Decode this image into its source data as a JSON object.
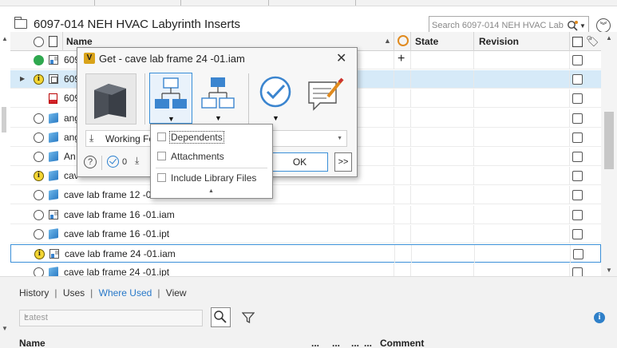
{
  "window": {
    "title": "6097-014 NEH HVAC Labyrinth Inserts",
    "search_placeholder": "Search 6097-014 NEH HVAC Labyrint"
  },
  "grid": {
    "columns": {
      "name": "Name",
      "state": "State",
      "revision": "Revision"
    },
    "rows": [
      {
        "name": "609",
        "status": "green",
        "type": "asm",
        "state_plus": true
      },
      {
        "name": "609",
        "status": "info",
        "type": "idw",
        "selected": true,
        "expandable": true
      },
      {
        "name": "609",
        "status": "none",
        "type": "pdf"
      },
      {
        "name": "ang",
        "status": "empty",
        "type": "part"
      },
      {
        "name": "ang",
        "status": "empty",
        "type": "part"
      },
      {
        "name": "An",
        "status": "empty",
        "type": "part"
      },
      {
        "name": "cav",
        "status": "info",
        "type": "part"
      },
      {
        "name": "cave lab frame 12 -01.",
        "status": "empty",
        "type": "part"
      },
      {
        "name": "cave lab frame 16 -01.iam",
        "status": "empty",
        "type": "asm"
      },
      {
        "name": "cave lab frame 16 -01.ipt",
        "status": "empty",
        "type": "part"
      },
      {
        "name": "cave lab frame 24 -01.iam",
        "status": "info",
        "type": "asm",
        "focused": true
      },
      {
        "name": "cave lab frame 24 -01.ipt",
        "status": "empty",
        "type": "part"
      }
    ]
  },
  "bottom_panel": {
    "tabs": [
      {
        "label": "History"
      },
      {
        "label": "Uses"
      },
      {
        "label": "Where Used",
        "active": true
      },
      {
        "label": "View"
      }
    ],
    "version_select": "Latest",
    "columns": {
      "name": "Name",
      "dots1": "...",
      "dots2": "...",
      "dots3": "...",
      "dots4": "...",
      "comment": "Comment"
    }
  },
  "dialog": {
    "title": "Get - cave lab frame 24 -01.iam",
    "close": "✕",
    "working_folder": "Working Fo",
    "count": "0",
    "ok_label": "OK",
    "more_label": ">>"
  },
  "popup_menu": {
    "items": [
      {
        "label": "Dependents",
        "checked": false
      },
      {
        "label": "Attachments",
        "checked": false
      },
      {
        "label": "Include Library Files",
        "checked": false
      }
    ]
  },
  "colors": {
    "accent": "#3a8fd8",
    "link_active": "#2979c9",
    "status_green": "#2fa84f",
    "status_info": "#f3d533",
    "selection": "#d6eaf8"
  }
}
